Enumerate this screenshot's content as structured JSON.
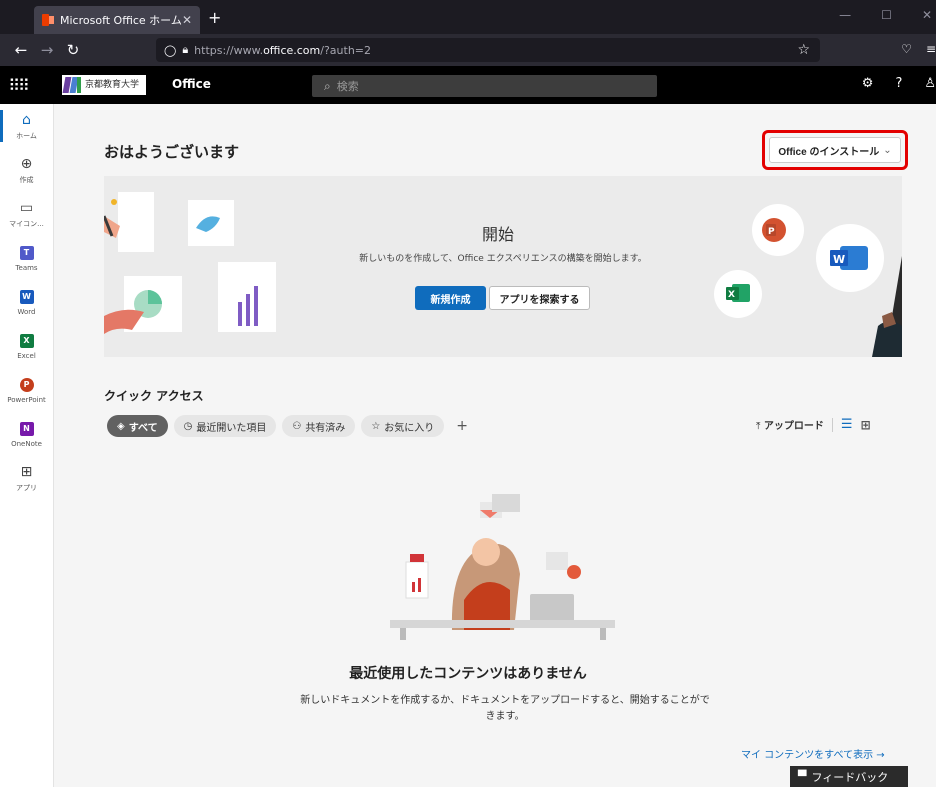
{
  "browser": {
    "tab_title": "Microsoft Office ホーム",
    "url_prefix": "https://www.",
    "url_domain": "office.com",
    "url_suffix": "/?auth=2"
  },
  "header": {
    "org_name": "京都教育大学",
    "app_name": "Office",
    "search_placeholder": "検索"
  },
  "rail": {
    "items": [
      {
        "label": "ホーム",
        "icon": "home-icon"
      },
      {
        "label": "作成",
        "icon": "create-icon"
      },
      {
        "label": "マイコン...",
        "icon": "folder-icon"
      },
      {
        "label": "Teams",
        "icon": "teams-icon",
        "color": "#5059c9",
        "letter": "T"
      },
      {
        "label": "Word",
        "icon": "word-icon",
        "color": "#185abd",
        "letter": "W"
      },
      {
        "label": "Excel",
        "icon": "excel-icon",
        "color": "#107c41",
        "letter": "X"
      },
      {
        "label": "PowerPoint",
        "icon": "powerpoint-icon",
        "color": "#c43e1c",
        "letter": "P"
      },
      {
        "label": "OneNote",
        "icon": "onenote-icon",
        "color": "#7719aa",
        "letter": "N"
      },
      {
        "label": "アプリ",
        "icon": "apps-icon"
      }
    ]
  },
  "main": {
    "greeting": "おはようございます",
    "install_label": "Office のインストール",
    "hero": {
      "title": "開始",
      "subtitle": "新しいものを作成して、Office エクスペリエンスの構築を開始します。",
      "new_button": "新規作成",
      "explore_button": "アプリを探索する"
    },
    "quick_access": {
      "title": "クイック アクセス",
      "filters": [
        "すべて",
        "最近開いた項目",
        "共有済み",
        "お気に入り"
      ],
      "upload_label": "アップロード"
    },
    "empty": {
      "title": "最近使用したコンテンツはありません",
      "description": "新しいドキュメントを作成するか、ドキュメントをアップロードすると、開始することができます。"
    },
    "show_all": "マイ コンテンツをすべて表示 →",
    "feedback": "フィードバック"
  },
  "colors": {
    "accent": "#0f6cbd",
    "highlight_border": "#e30000"
  }
}
